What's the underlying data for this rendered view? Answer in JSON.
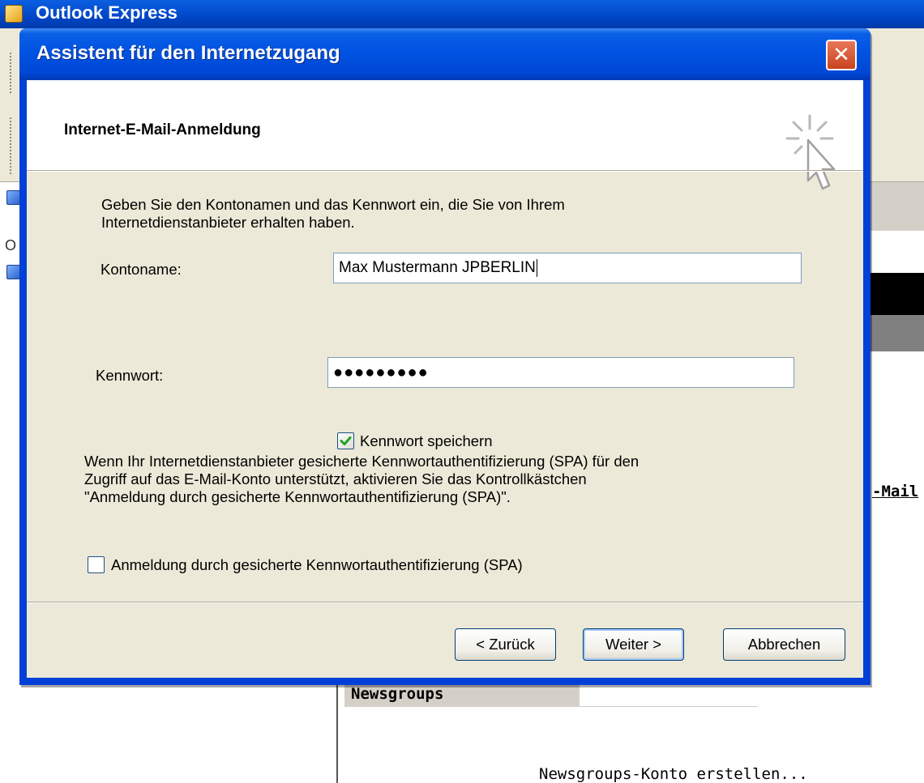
{
  "background_app": {
    "title": "Outlook Express",
    "sidebar_letter": "O",
    "mail_link_fragment": "-Mail",
    "newsgroups_header": "Newsgroups",
    "newsgroups_link": "Newsgroups-Konto erstellen..."
  },
  "dialog": {
    "title": "Assistent für den Internetzugang",
    "close_glyph": "✕",
    "heading": "Internet-E-Mail-Anmeldung",
    "intro_line1": "Geben Sie den Kontonamen und das Kennwort ein, die Sie von Ihrem",
    "intro_line2": "Internetdienstanbieter erhalten haben.",
    "account_label": "Kontoname:",
    "account_value": "Max Mustermann JPBERLIN",
    "password_label": "Kennwort:",
    "password_value": "●●●●●●●●●",
    "save_password": {
      "label": "Kennwort speichern",
      "checked": true
    },
    "spa_text_line1": "Wenn Ihr Internetdienstanbieter gesicherte Kennwortauthentifizierung (SPA) für den",
    "spa_text_line2": "Zugriff auf das E-Mail-Konto unterstützt, aktivieren Sie das Kontrollkästchen",
    "spa_text_line3": "\"Anmeldung durch gesicherte Kennwortauthentifizierung (SPA)\".",
    "spa_checkbox": {
      "label": "Anmeldung durch gesicherte Kennwortauthentifizierung (SPA)",
      "checked": false
    },
    "buttons": {
      "back": "< Zurück",
      "next": "Weiter >",
      "cancel": "Abbrechen"
    }
  },
  "icons": {
    "wizard": "sparkle-cursor-icon",
    "check": "checkmark-icon",
    "app": "outlook-express-icon"
  },
  "colors": {
    "titlebar_blue": "#0053e1",
    "close_red": "#c9431f",
    "dialog_face": "#ece9d8",
    "checkmark_green": "#21a121"
  }
}
